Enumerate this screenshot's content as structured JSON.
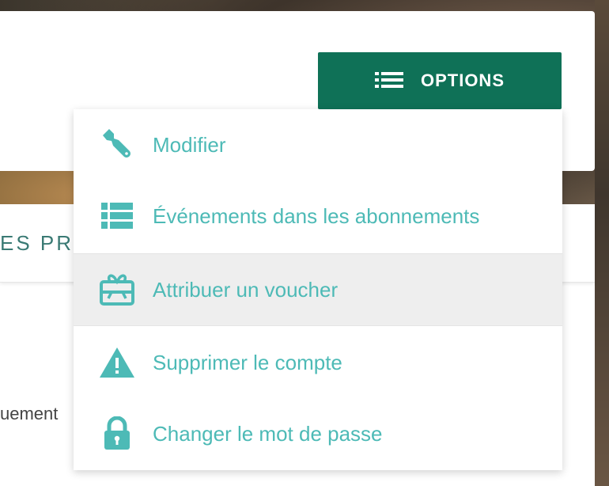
{
  "header": {
    "options_label": "OPTIONS"
  },
  "page": {
    "section_title": "ES PR",
    "body_fragment": "uement"
  },
  "menu": {
    "items": [
      {
        "label": "Modifier",
        "icon": "wrench-icon"
      },
      {
        "label": "Événements dans les abonnements",
        "icon": "list-icon"
      },
      {
        "label": "Attribuer un voucher",
        "icon": "gift-card-icon",
        "highlighted": true
      },
      {
        "label": "Supprimer le compte",
        "icon": "warning-icon"
      },
      {
        "label": "Changer le mot de passe",
        "icon": "lock-icon"
      }
    ]
  },
  "colors": {
    "button_bg": "#0f7157",
    "menu_text": "#4dbab6",
    "highlight_bg": "#eeeeee"
  }
}
